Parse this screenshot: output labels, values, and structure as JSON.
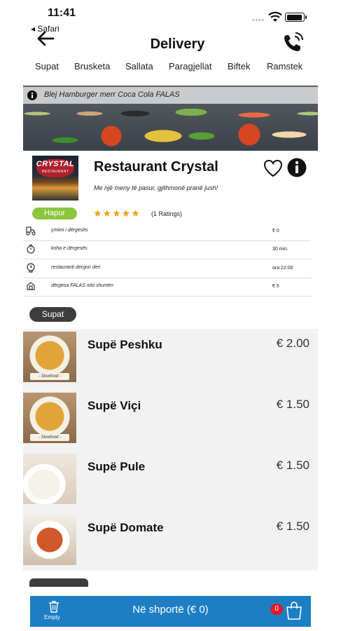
{
  "status_bar": {
    "time": "11:41",
    "back_app": "◂ Safari"
  },
  "header": {
    "title": "Delivery"
  },
  "categories": [
    "Supat",
    "Brusketa",
    "Sallata",
    "Paragjellat",
    "Biftek",
    "Ramstek"
  ],
  "promo": {
    "text": "Blej Hamburger merr Coca Cola FALAS"
  },
  "restaurant": {
    "logo_text": "CRYSTAL",
    "logo_subtext": "RESTAURANT",
    "name": "Restaurant Crystal",
    "slogan": "Me një meny të pasur, gjithmonë pranë jush!",
    "status": "Hapur",
    "rating_stars": 5,
    "stars": "★★★★★",
    "ratings_text": "(1  Ratings)"
  },
  "info_rows": [
    {
      "icon": "delivery-cost-icon",
      "label": "çmimi i dërgesës",
      "value": "€ 0"
    },
    {
      "icon": "stopwatch-icon",
      "label": "koha e dërgesës",
      "value": "30 min."
    },
    {
      "icon": "clock-icon",
      "label": "restauranti dergon deri",
      "value": "ora  22:00"
    },
    {
      "icon": "free-delivery-icon",
      "label": "dërgesa FALAS mbi shumën",
      "value": "€ 5"
    }
  ],
  "section": {
    "title": "Supat"
  },
  "menu_items": [
    {
      "name": "Supë Peshku",
      "price": "€ 2.00",
      "thumb_label": "- Slowfood -"
    },
    {
      "name": "Supë Viçi",
      "price": "€ 1.50",
      "thumb_label": "- Slowfood -"
    },
    {
      "name": "Supë Pule",
      "price": "€ 1.50"
    },
    {
      "name": "Supë Domate",
      "price": "€ 1.50"
    }
  ],
  "cart": {
    "empty_label": "Empty",
    "label": "Në shportë (€ 0)",
    "count": "0"
  },
  "colors": {
    "accent_blue": "#1d7ec4",
    "open_green": "#8cc63e",
    "star": "#f0a010",
    "badge_red": "#e0192b"
  }
}
